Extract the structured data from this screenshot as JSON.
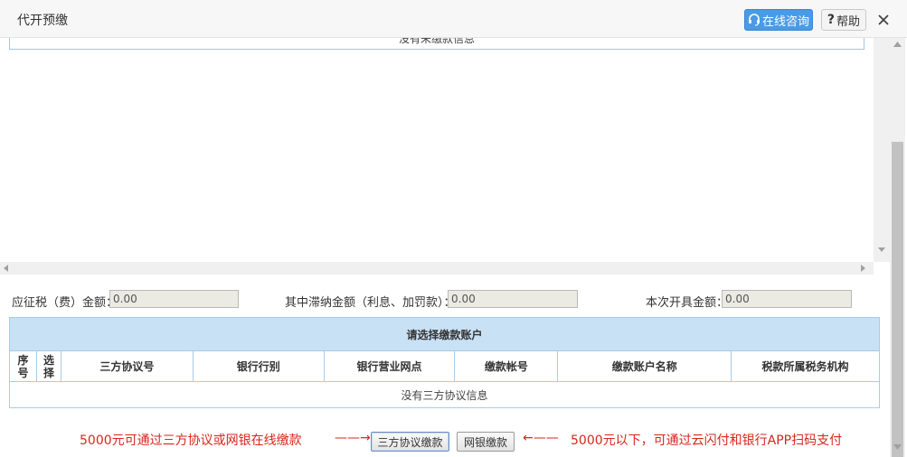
{
  "header": {
    "title": "代开预缴",
    "online_label": "在线咨询",
    "help_label": "帮助"
  },
  "unpaid": {
    "empty_text": "没有未缴款信息"
  },
  "amounts": {
    "tax_label": "应征税（费）金额：",
    "tax_value": "0.00",
    "late_label": "其中滞纳金额（利息、加罚款）：",
    "late_value": "0.00",
    "invoice_label": "本次开具金额：",
    "invoice_value": "0.00"
  },
  "accounts": {
    "caption": "请选择缴款账户",
    "columns": [
      "序号",
      "选择",
      "三方协议号",
      "银行行别",
      "银行营业网点",
      "缴款帐号",
      "缴款账户名称",
      "税款所属税务机构"
    ],
    "empty_text": "没有三方协议信息"
  },
  "actions": {
    "left_note": "5000元可通过三方协议或网银在线缴款",
    "left_arrow": "——→",
    "tripartite_label": "三方协议缴款",
    "ebank_label": "网银缴款",
    "right_arrow": "←——",
    "right_note": "5000元以下，可通过云闪付和银行APP扫码支付"
  },
  "colors": {
    "accent": "#4a9be6",
    "note_red": "#d7261b",
    "table_header_bg": "#c9e1f5",
    "table_border": "#a9cbe7"
  },
  "icons": {
    "online": "headset-icon",
    "help": "question-mark-icon",
    "close": "close-icon"
  }
}
